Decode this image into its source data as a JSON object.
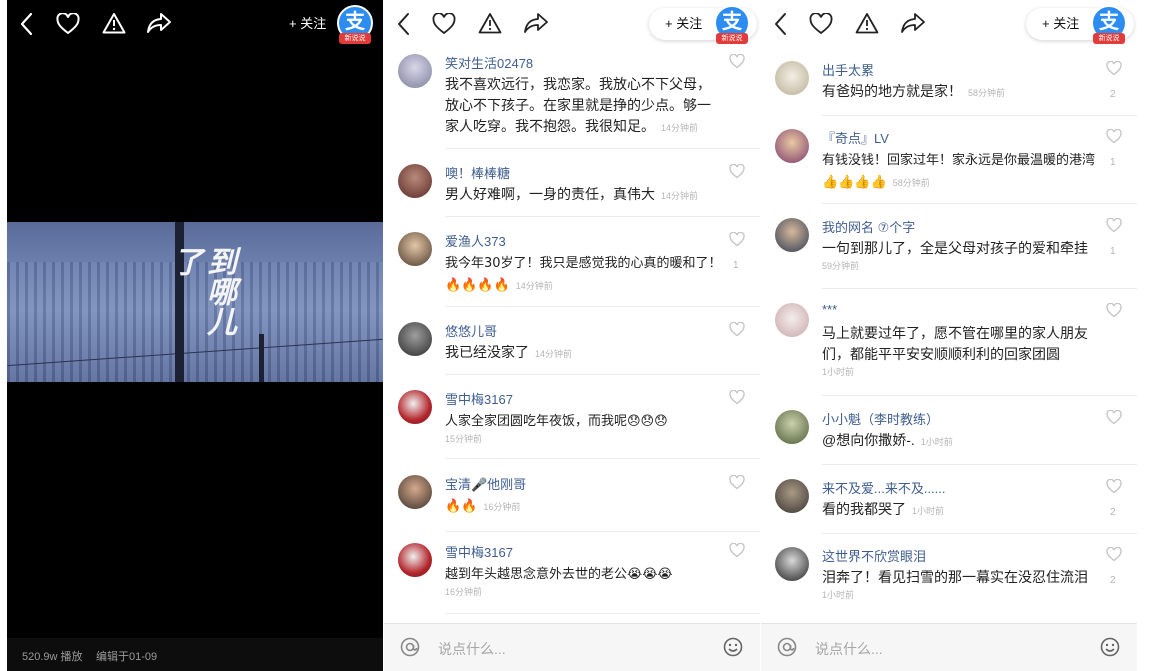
{
  "panels": {
    "video": {
      "follow_label": "+ 关注",
      "badge_glyph": "支",
      "badge_tag": "新说说",
      "video_title": "到哪儿了",
      "plays": "520.9w 播放",
      "edited": "编辑于01-09"
    },
    "comments_a": {
      "follow_label": "+ 关注",
      "badge_glyph": "支",
      "badge_tag": "新说说",
      "input_placeholder": "说点什么...",
      "comments": [
        {
          "user": "笑对生活02478",
          "text": "我不喜欢远行，我恋家。我放心不下父母，放心不下孩子。在家里就是挣的少点。够一家人吃穿。我不抱怨。我很知足。",
          "time": "14分钟前",
          "likes": ""
        },
        {
          "user": "噢！棒棒糖",
          "text": "男人好难啊，一身的责任，真伟大",
          "time": "14分钟前",
          "likes": ""
        },
        {
          "user": "爱渔人373",
          "text": "我今年30岁了！我只是感觉我的心真的暖和了！🔥🔥🔥🔥",
          "time": "14分钟前",
          "likes": "1"
        },
        {
          "user": "悠悠儿哥",
          "text": "我已经没家了",
          "time": "14分钟前",
          "likes": ""
        },
        {
          "user": "雪中梅3167",
          "text": "人家全家团圆吃年夜饭，而我呢😞😞😞",
          "time": "15分钟前",
          "likes": ""
        },
        {
          "user": "宝清🎤他刚哥",
          "text": "🔥🔥",
          "time": "16分钟前",
          "likes": ""
        },
        {
          "user": "雪中梅3167",
          "text": "越到年头越思念意外去世的老公😭😭😭",
          "time": "16分钟前",
          "likes": ""
        }
      ]
    },
    "comments_b": {
      "follow_label": "+ 关注",
      "badge_glyph": "支",
      "badge_tag": "新说说",
      "input_placeholder": "说点什么...",
      "comments": [
        {
          "user": "出手太累",
          "text": "有爸妈的地方就是家！",
          "time": "58分钟前",
          "likes": "2"
        },
        {
          "user": "『奇点』LV",
          "text": "有钱没钱！回家过年！家永远是你最温暖的港湾👍👍👍👍",
          "time": "58分钟前",
          "likes": "1"
        },
        {
          "user": "我的网名 ⑦个字",
          "text": "一句到那儿了，全是父母对孩子的爱和牵挂",
          "time": "59分钟前",
          "likes": "1"
        },
        {
          "user": "***",
          "text": "马上就要过年了，愿不管在哪里的家人朋友们，都能平平安安顺顺利利的回家团圆",
          "time": "1小时前",
          "likes": ""
        },
        {
          "user": "小小魁（李时教练）",
          "text": "@想向你撒娇-.",
          "time": "1小时前",
          "likes": ""
        },
        {
          "user": "来不及爱...来不及......",
          "text": "看的我都哭了",
          "time": "1小时前",
          "likes": "2"
        },
        {
          "user": "这世界不欣赏眼泪",
          "text": "泪奔了！看见扫雪的那一幕实在没忍住流泪",
          "time": "1小时前",
          "likes": "2"
        }
      ]
    }
  },
  "icons": [
    "back-icon",
    "heart-icon",
    "warning-icon",
    "share-icon",
    "at-icon",
    "emoji-icon"
  ],
  "colors": {
    "username": "#3f5e8f",
    "badge": "#2d8cf0",
    "badge_tag": "#e23b3b",
    "time": "#b5b5b5"
  }
}
